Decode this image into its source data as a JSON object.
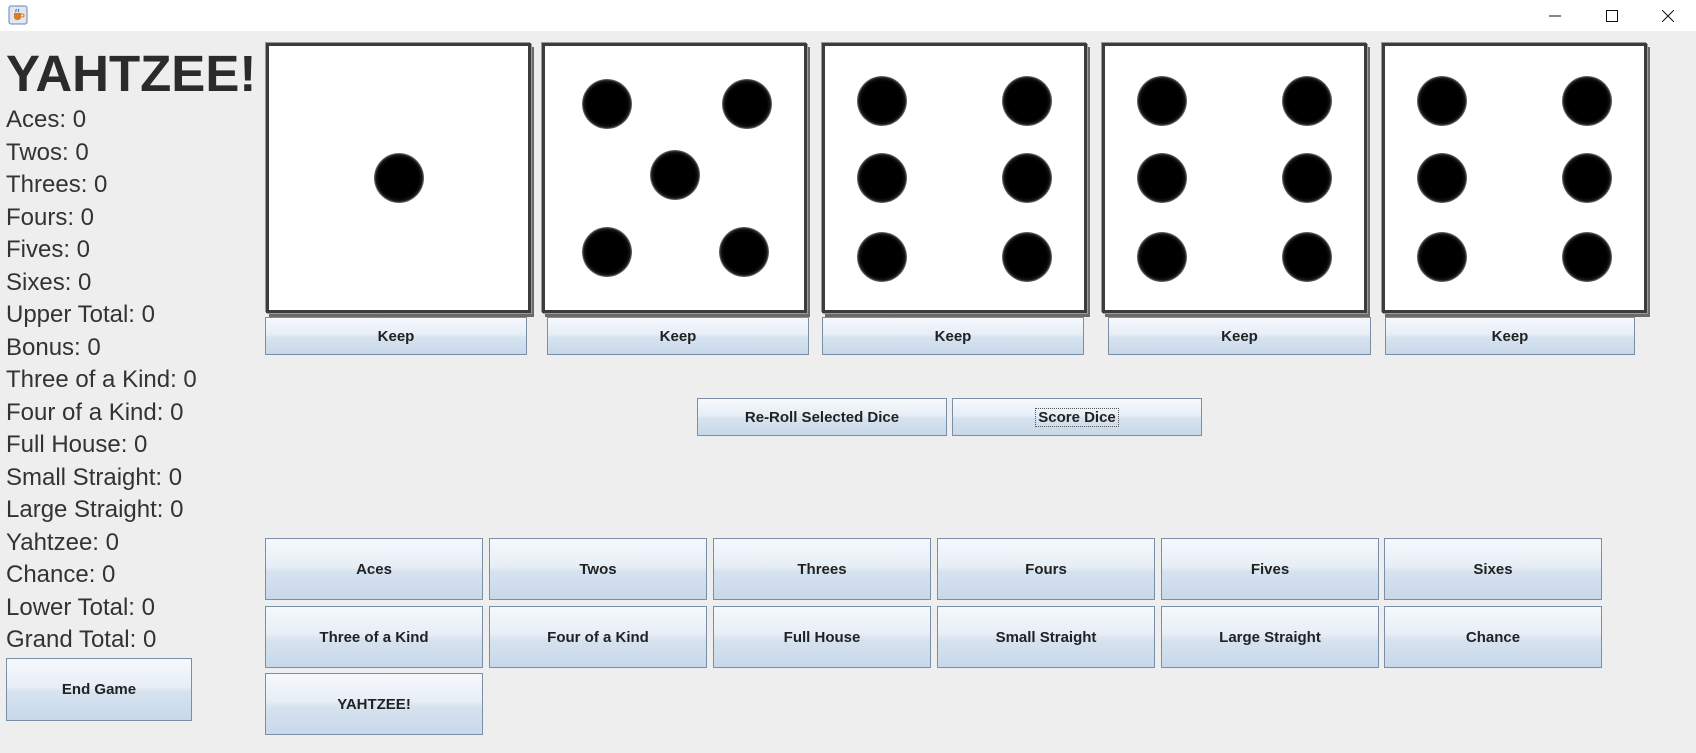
{
  "window": {
    "icon": "java-coffee-cup-icon",
    "controls": [
      "minimize-icon",
      "maximize-icon",
      "close-icon"
    ]
  },
  "app_title": "YAHTZEE!",
  "scores": [
    "Aces: 0",
    "Twos: 0",
    "Threes: 0",
    "Fours: 0",
    "Fives: 0",
    "Sixes: 0",
    "Upper Total: 0",
    "Bonus: 0",
    "Three of a Kind: 0",
    "Four of a Kind: 0",
    "Full House: 0",
    "Small Straight: 0",
    "Large Straight: 0",
    "Yahtzee: 0",
    "Chance: 0",
    "Lower Total: 0",
    "Grand Total: 0"
  ],
  "dice": [
    {
      "value": 1,
      "keep_label": "Keep"
    },
    {
      "value": 5,
      "keep_label": "Keep"
    },
    {
      "value": 6,
      "keep_label": "Keep"
    },
    {
      "value": 6,
      "keep_label": "Keep"
    },
    {
      "value": 6,
      "keep_label": "Keep"
    }
  ],
  "actions": {
    "reroll_label": "Re-Roll Selected Dice",
    "score_label": "Score Dice"
  },
  "score_buttons": {
    "upper": [
      "Aces",
      "Twos",
      "Threes",
      "Fours",
      "Fives",
      "Sixes"
    ],
    "lower": [
      "Three of a Kind",
      "Four of a Kind",
      "Full House",
      "Small Straight",
      "Large Straight",
      "Chance"
    ],
    "yahtzee": "YAHTZEE!"
  },
  "end_game_label": "End Game"
}
